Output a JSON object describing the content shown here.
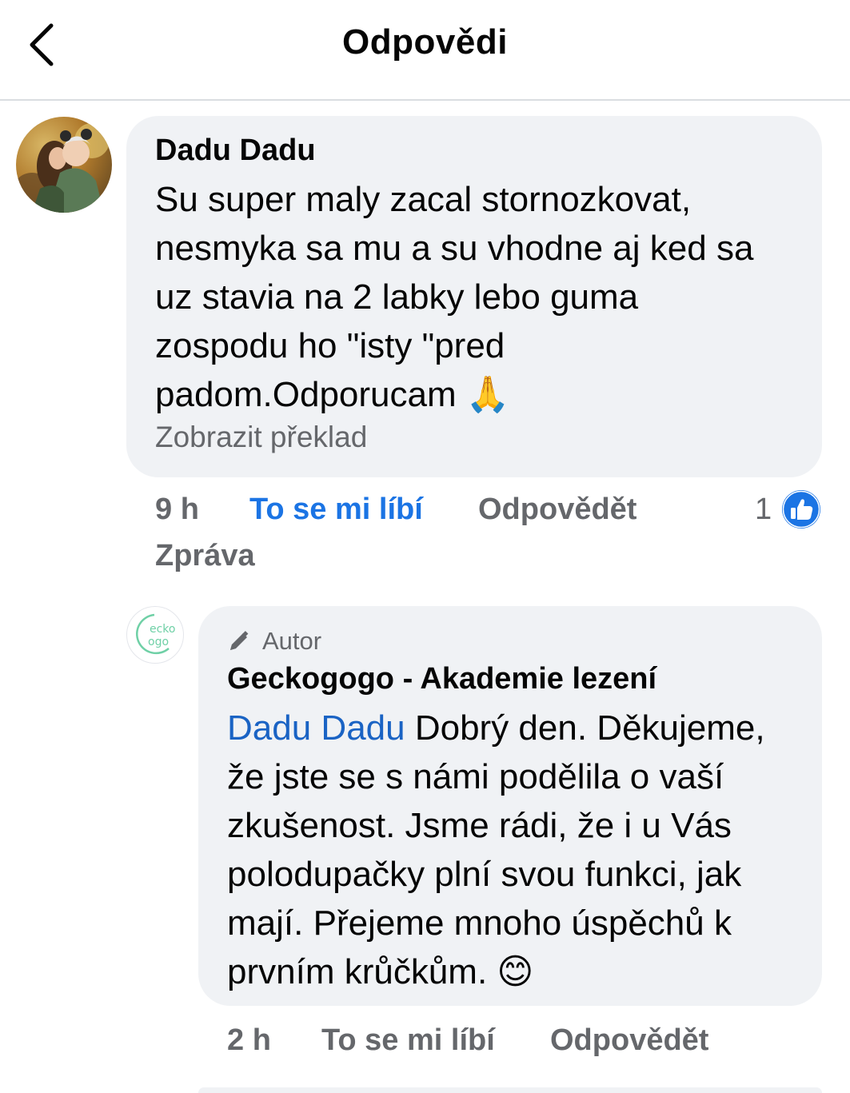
{
  "header": {
    "title": "Odpovědi",
    "back_icon": "back-chevron-icon"
  },
  "comment": {
    "author": "Dadu Dadu",
    "text": "Su super maly zacal stornozkovat, nesmyka sa mu a su vhodne aj ked sa uz stavia na 2 labky lebo guma zospodu ho \"isty \"pred padom.Odporucam",
    "emoji": "🙏",
    "translate_label": "Zobrazit překlad",
    "time": "9 h",
    "like_label": "To se mi líbí",
    "reply_label": "Odpovědět",
    "message_label": "Zpráva",
    "reaction_count": "1",
    "reaction_icon": "like-thumb-icon",
    "like_color": "#1b74e4"
  },
  "reply": {
    "badge_label": "Autor",
    "badge_icon": "pencil-icon",
    "author": "Geckogogo - Akademie lezení",
    "mention": "Dadu Dadu",
    "text": " Dobrý den. Děkujeme, že jste se s námi podělila o vaší zkušenost. Jsme rádi, že i u Vás polodupačky plní svou funkci, jak mají. Přejeme mnoho úspěchů k prvním krůčkům.",
    "emoji": "😊",
    "time": "2 h",
    "like_label": "To se mi líbí",
    "reply_label": "Odpovědět",
    "mention_color": "#1a63c4"
  }
}
